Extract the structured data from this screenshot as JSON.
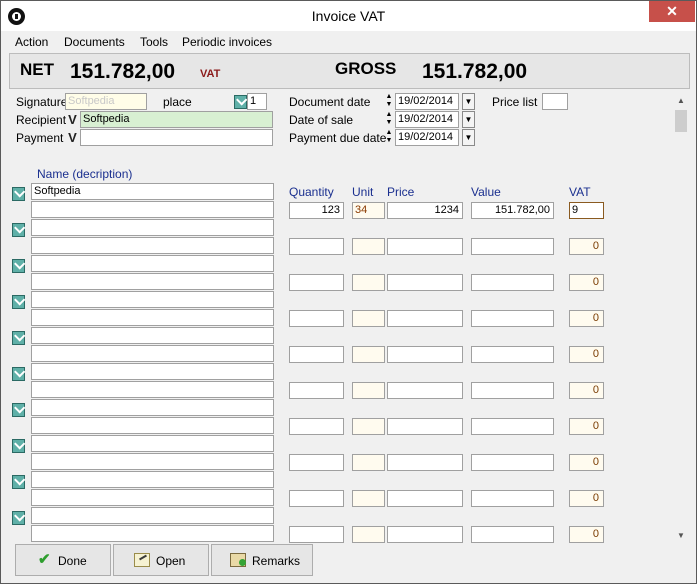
{
  "window": {
    "title": "Invoice VAT",
    "close": "✕"
  },
  "menu": [
    "Action",
    "Documents",
    "Tools",
    "Periodic invoices"
  ],
  "totals": {
    "net_label": "NET",
    "net_value": "151.782,00",
    "vat_label": "VAT",
    "gross_label": "GROSS",
    "gross_value": "151.782,00"
  },
  "header_form": {
    "signature_label": "Signature",
    "signature_value": "Softpedia",
    "place_label": "place",
    "place_value": "1",
    "recipient_label": "Recipient",
    "recipient_value": "Softpedia",
    "payment_label": "Payment",
    "payment_value": "",
    "document_date_label": "Document date",
    "document_date": "19/02/2014",
    "date_of_sale_label": "Date of sale",
    "date_of_sale": "19/02/2014",
    "payment_due_label": "Payment due date",
    "payment_due_date": "19/02/2014",
    "price_list_label": "Price list",
    "price_list_value": ""
  },
  "items": {
    "name_header": "Name  (decription)",
    "columns": {
      "quantity": "Quantity",
      "unit": "Unit",
      "price": "Price",
      "value": "Value",
      "vat": "VAT"
    },
    "rows": [
      {
        "name": "Softpedia",
        "name2": "",
        "quantity": "123",
        "unit": "34",
        "price": "1234",
        "value": "151.782,00",
        "vat": "9"
      },
      {
        "name": "",
        "name2": "",
        "quantity": "",
        "unit": "",
        "price": "",
        "value": "",
        "vat": "0"
      },
      {
        "name": "",
        "name2": "",
        "quantity": "",
        "unit": "",
        "price": "",
        "value": "",
        "vat": "0"
      },
      {
        "name": "",
        "name2": "",
        "quantity": "",
        "unit": "",
        "price": "",
        "value": "",
        "vat": "0"
      },
      {
        "name": "",
        "name2": "",
        "quantity": "",
        "unit": "",
        "price": "",
        "value": "",
        "vat": "0"
      },
      {
        "name": "",
        "name2": "",
        "quantity": "",
        "unit": "",
        "price": "",
        "value": "",
        "vat": "0"
      },
      {
        "name": "",
        "name2": "",
        "quantity": "",
        "unit": "",
        "price": "",
        "value": "",
        "vat": "0"
      },
      {
        "name": "",
        "name2": "",
        "quantity": "",
        "unit": "",
        "price": "",
        "value": "",
        "vat": "0"
      },
      {
        "name": "",
        "name2": "",
        "quantity": "",
        "unit": "",
        "price": "",
        "value": "",
        "vat": "0"
      },
      {
        "name": "",
        "name2": "",
        "quantity": "",
        "unit": "",
        "price": "",
        "value": "",
        "vat": "0"
      }
    ]
  },
  "buttons": {
    "done": "Done",
    "open": "Open",
    "remarks": "Remarks"
  },
  "icons": {
    "done": "check-icon",
    "open": "open-document-icon",
    "remarks": "remarks-icon",
    "row_select": "teal-check-icon"
  },
  "colors": {
    "column_header": "#1a2f8f",
    "recipient_bg": "#d8f0d2",
    "close_button": "#c7504a",
    "vat_text": "#8b1a1a"
  }
}
